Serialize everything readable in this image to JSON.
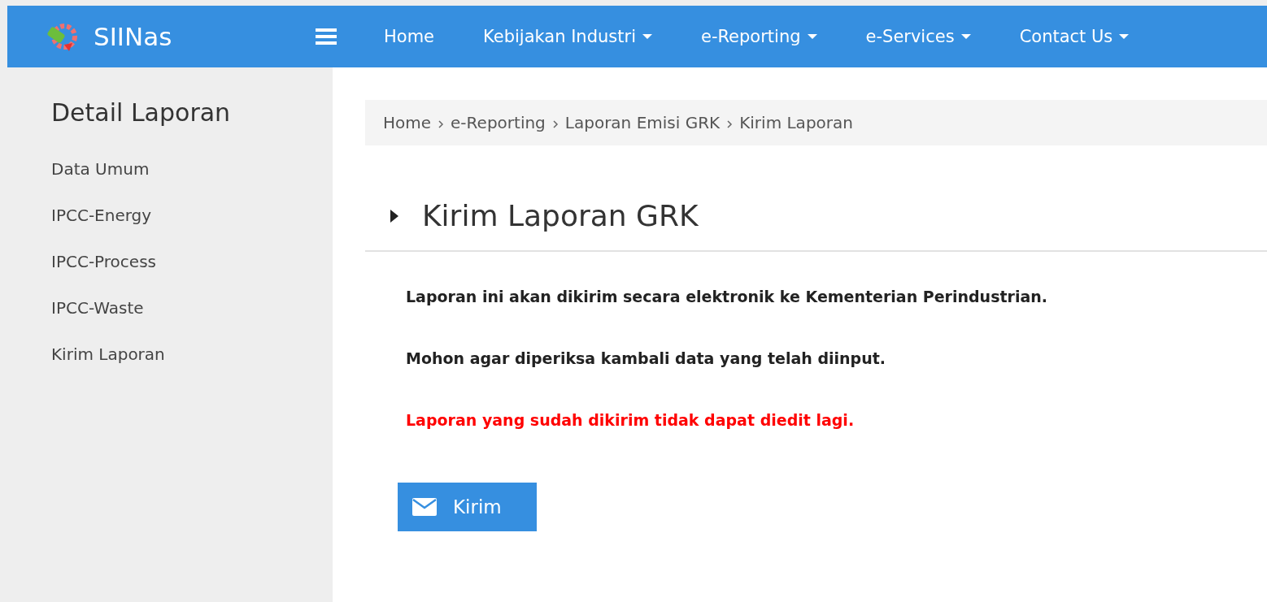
{
  "header": {
    "brand": "SIINas",
    "nav": [
      {
        "label": "Home",
        "dropdown": false
      },
      {
        "label": "Kebijakan Industri",
        "dropdown": true
      },
      {
        "label": "e-Reporting",
        "dropdown": true
      },
      {
        "label": "e-Services",
        "dropdown": true
      },
      {
        "label": "Contact Us",
        "dropdown": true
      }
    ]
  },
  "sidebar": {
    "title": "Detail Laporan",
    "items": [
      "Data Umum",
      "IPCC-Energy",
      "IPCC-Process",
      "IPCC-Waste",
      "Kirim Laporan"
    ]
  },
  "breadcrumb": [
    "Home",
    "e-Reporting",
    "Laporan Emisi GRK",
    "Kirim Laporan"
  ],
  "section": {
    "title": "Kirim Laporan GRK"
  },
  "messages": [
    {
      "text": "Laporan ini akan dikirim secara elektronik ke Kementerian Perindustrian.",
      "kind": "info"
    },
    {
      "text": "Mohon agar diperiksa kambali data yang telah diinput.",
      "kind": "info"
    },
    {
      "text": "Laporan yang sudah dikirim tidak dapat diedit lagi.",
      "kind": "warning"
    }
  ],
  "submit_button": {
    "label": "Kirim"
  }
}
